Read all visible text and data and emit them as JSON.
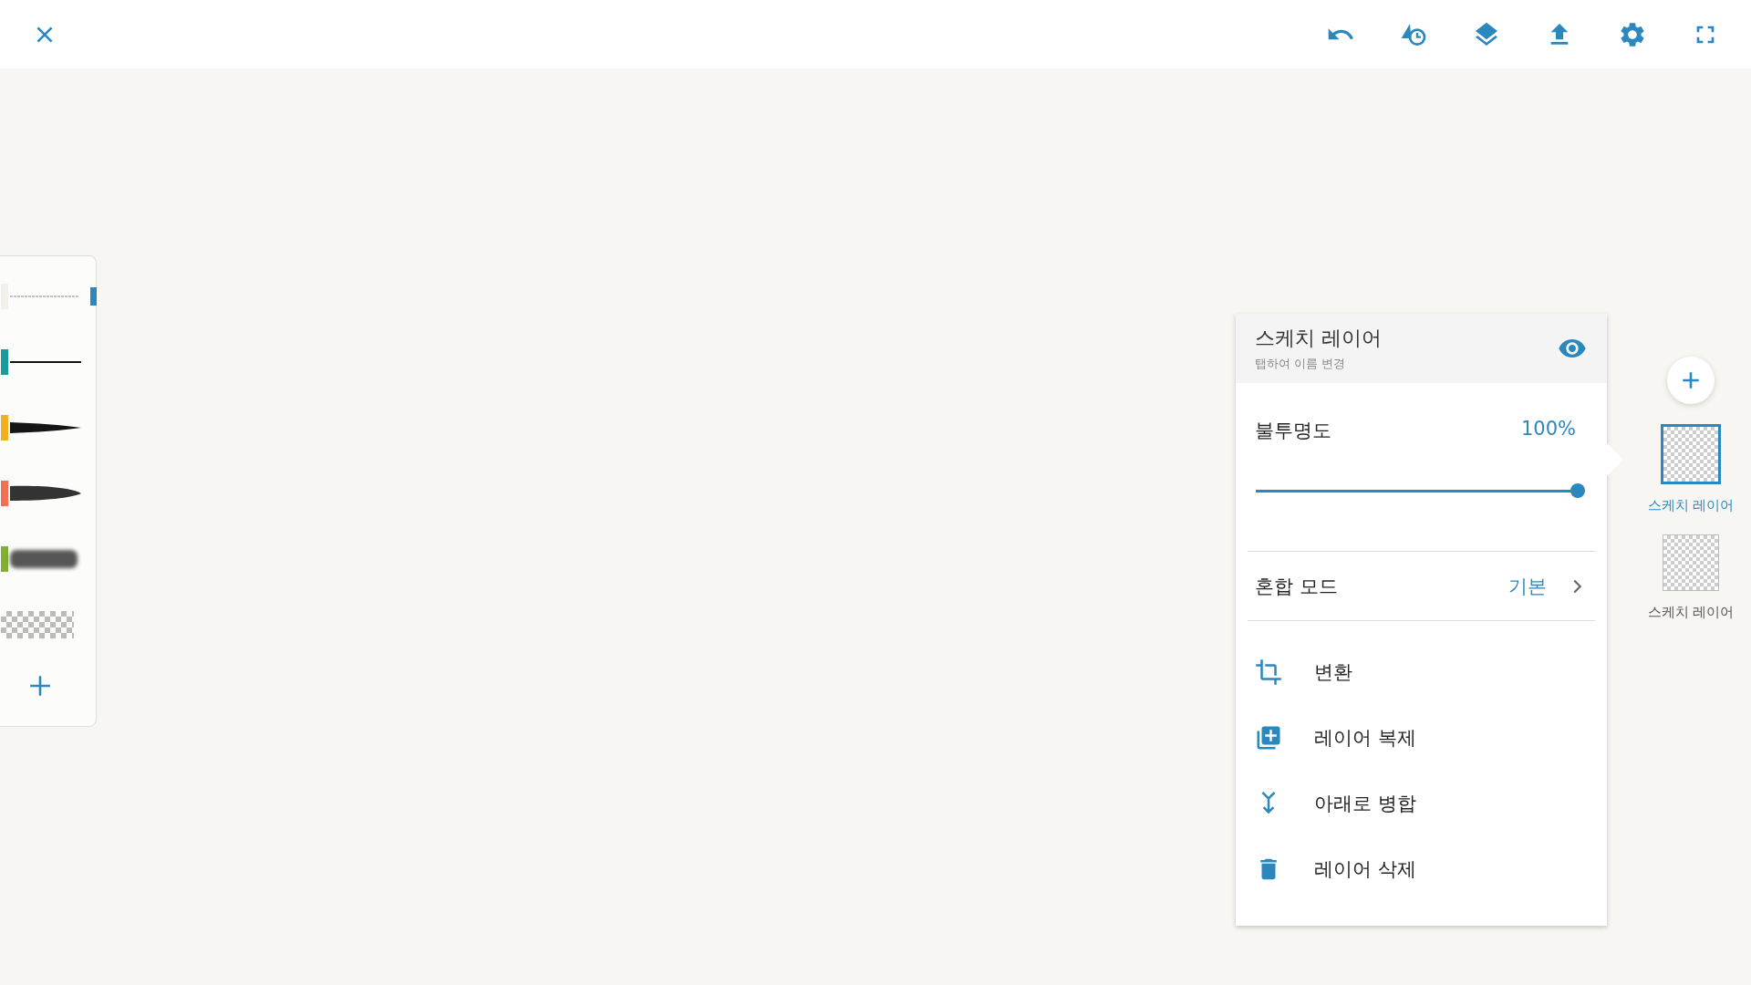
{
  "brushes": [
    {
      "kind": "pencil",
      "color": "#f2f0ea",
      "selected": true
    },
    {
      "kind": "pen",
      "color": "#1a9a9a",
      "selected": false
    },
    {
      "kind": "ink",
      "color": "#f0b020",
      "selected": false
    },
    {
      "kind": "marker",
      "color": "#f07050",
      "selected": false
    },
    {
      "kind": "airbrush",
      "color": "#80b030",
      "selected": false
    },
    {
      "kind": "eraser",
      "selected": false
    }
  ],
  "layer_panel": {
    "title": "스케치 레이어",
    "subtitle": "탭하여 이름 변경",
    "visible": true,
    "opacity": {
      "label": "불투명도",
      "value": "100%",
      "level": 1
    },
    "blend": {
      "label": "혼합 모드",
      "value": "기본"
    },
    "actions": [
      {
        "kind": "transform",
        "label": "변환"
      },
      {
        "kind": "duplicate",
        "label": "레이어 복제"
      },
      {
        "kind": "merge",
        "label": "아래로 병합"
      },
      {
        "kind": "delete",
        "label": "레이어 삭제"
      }
    ]
  },
  "layers": [
    {
      "name": "스케치 레이어",
      "selected": true
    },
    {
      "name": "스케치 레이어",
      "selected": false
    }
  ]
}
